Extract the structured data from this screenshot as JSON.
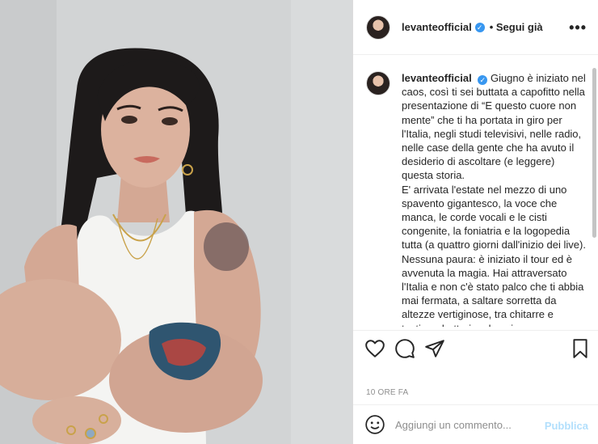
{
  "post": {
    "username": "levanteofficial",
    "verified_badge": "✓",
    "follow_status": "• Segui già",
    "more_label": "•••",
    "caption_username": "levanteofficial",
    "caption_text": "Giugno è iniziato nel caos, così ti sei buttata a capofitto nella presentazione di “E questo cuore non mente” che ti ha portata in giro per l'Italia, negli studi televisivi, nelle radio, nelle case della gente che ha avuto il desiderio di ascoltare (e leggere) questa storia.\nE' arrivata l'estate nel mezzo di uno spavento gigantesco, la voce che manca, le corde vocali e le cisti congenite, la foniatria e la logopedia tutta (a quattro giorni dall'inizio dei live). Nessuna paura: è iniziato il tour ed è avvenuta la magia. Hai attraversato l'Italia e non c'è stato palco che ti abbia mai fermata, a saltare sorretta da altezze vertiginose, tra chitarre e tastiere, batterie e bassi,",
    "timestamp": "10 ORE FA"
  },
  "icons": {
    "like": "heart-icon",
    "comment": "comment-icon",
    "share": "share-icon",
    "save": "bookmark-icon",
    "emoji": "emoji-icon",
    "more": "more-icon"
  },
  "comment_box": {
    "placeholder": "Aggiungi un commento...",
    "publish_label": "Pubblica"
  },
  "colors": {
    "verified": "#3897f0",
    "publish": "#b2dffc",
    "muted": "#8e8e8e"
  }
}
